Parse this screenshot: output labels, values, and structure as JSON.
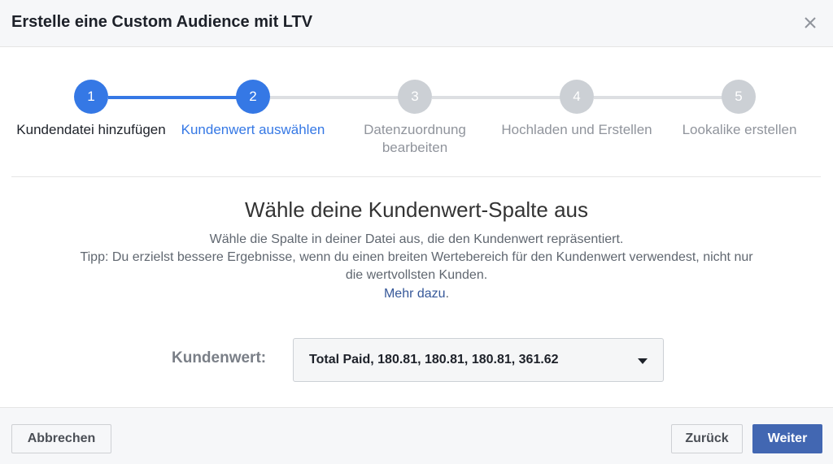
{
  "dialog": {
    "title": "Erstelle eine Custom Audience mit LTV",
    "close_icon": "close-icon"
  },
  "steps": [
    {
      "number": "1",
      "label": "Kundendatei hinzufügen",
      "state": "done"
    },
    {
      "number": "2",
      "label": "Kundenwert auswählen",
      "state": "active"
    },
    {
      "number": "3",
      "label": "Datenzuordnung bearbeiten",
      "state": "pending"
    },
    {
      "number": "4",
      "label": "Hochladen und Erstellen",
      "state": "pending"
    },
    {
      "number": "5",
      "label": "Lookalike erstellen",
      "state": "pending"
    }
  ],
  "content": {
    "heading": "Wähle deine Kundenwert-Spalte aus",
    "description": "Wähle die Spalte in deiner Datei aus, die den Kundenwert repräsentiert.",
    "tip_line1": "Tipp: Du erzielst bessere Ergebnisse, wenn du einen breiten Wertebereich für den Kundenwert verwendest, nicht nur",
    "tip_line2": "die wertvollsten Kunden.",
    "more_link": "Mehr dazu",
    "more_suffix": "."
  },
  "field": {
    "label": "Kundenwert:",
    "selected_value": "Total Paid, 180.81, 180.81, 180.81, 361.62"
  },
  "footer": {
    "cancel_label": "Abbrechen",
    "back_label": "Zurück",
    "next_label": "Weiter"
  },
  "colors": {
    "accent": "#3578e5",
    "inactive_step": "#ccd0d5",
    "link": "#365899",
    "primary_button": "#4267b2"
  }
}
